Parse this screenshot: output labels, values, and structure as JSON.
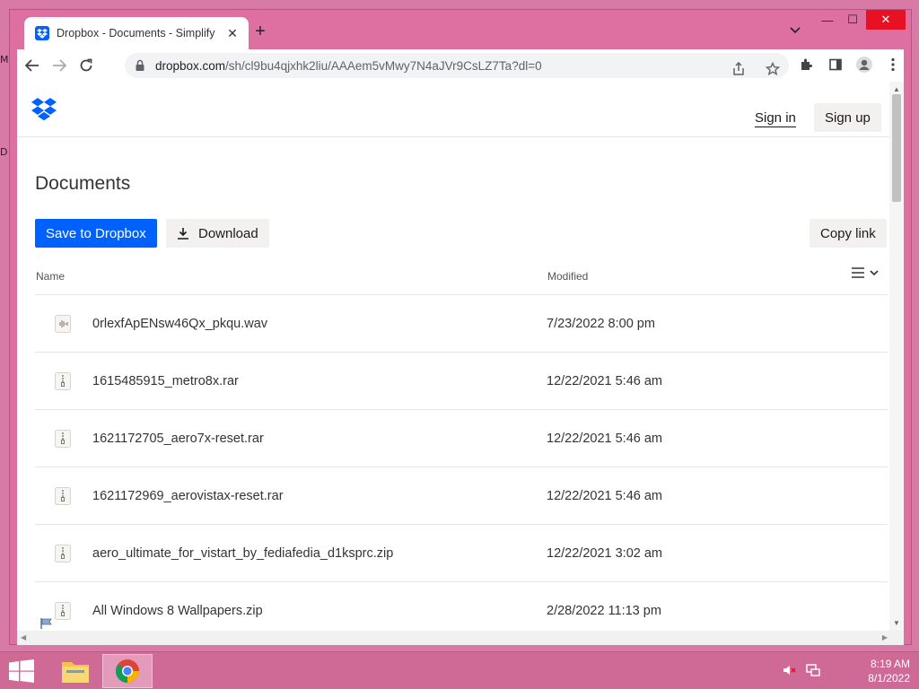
{
  "desktop": {
    "letters": [
      "M",
      "D"
    ]
  },
  "browser": {
    "tab_title": "Dropbox - Documents - Simplify",
    "tab_close": "✕",
    "new_tab": "+",
    "url_host": "dropbox.com",
    "url_path": "/sh/cl9bu4qjxhk2liu/AAAem5vMwy7N4aJVr9CsLZ7Ta?dl=0",
    "window_controls": {
      "minimize": "—",
      "maximize": "☐",
      "close": "✕"
    }
  },
  "site": {
    "sign_in": "Sign in",
    "sign_up": "Sign up",
    "folder_title": "Documents",
    "save_button": "Save to Dropbox",
    "download_button": "Download",
    "copy_link_button": "Copy link",
    "columns": {
      "name": "Name",
      "modified": "Modified"
    },
    "files": [
      {
        "name": "0rlexfApENsw46Qx_pkqu.wav",
        "modified": "7/23/2022 8:00 pm",
        "icon": "audio-file-icon"
      },
      {
        "name": "1615485915_metro8x.rar",
        "modified": "12/22/2021 5:46 am",
        "icon": "archive-file-icon"
      },
      {
        "name": "1621172705_aero7x-reset.rar",
        "modified": "12/22/2021 5:46 am",
        "icon": "archive-file-icon"
      },
      {
        "name": "1621172969_aerovistax-reset.rar",
        "modified": "12/22/2021 5:46 am",
        "icon": "archive-file-icon"
      },
      {
        "name": "aero_ultimate_for_vistart_by_fediafedia_d1ksprc.zip",
        "modified": "12/22/2021 3:02 am",
        "icon": "archive-file-icon"
      },
      {
        "name": "All Windows 8 Wallpapers.zip",
        "modified": "2/28/2022 11:13 pm",
        "icon": "archive-file-icon"
      }
    ]
  },
  "taskbar": {
    "time": "8:19 AM",
    "date": "8/1/2022"
  },
  "colors": {
    "dropbox_blue": "#0061fe",
    "desktop_pink": "#d97aa6"
  }
}
